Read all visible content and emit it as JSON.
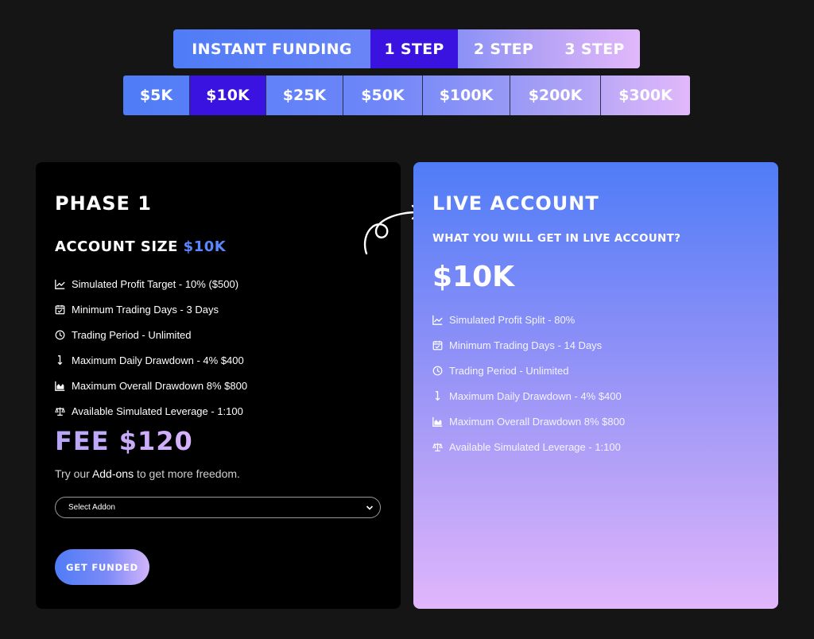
{
  "tabs": [
    {
      "label": "INSTANT FUNDING",
      "active": false
    },
    {
      "label": "1 STEP",
      "active": true
    },
    {
      "label": "2 STEP",
      "active": false
    },
    {
      "label": "3 STEP",
      "active": false
    }
  ],
  "sizes": [
    {
      "label": "$5K",
      "active": false
    },
    {
      "label": "$10K",
      "active": true
    },
    {
      "label": "$25K",
      "active": false
    },
    {
      "label": "$50K",
      "active": false
    },
    {
      "label": "$100K",
      "active": false
    },
    {
      "label": "$200K",
      "active": false
    },
    {
      "label": "$300K",
      "active": false
    }
  ],
  "phase": {
    "title": "PHASE 1",
    "size_label": "ACCOUNT SIZE",
    "size_value": "$10K",
    "features": [
      {
        "icon": "chart-line-icon",
        "text": "Simulated Profit Target - 10% ($500)"
      },
      {
        "icon": "calendar-check-icon",
        "text": "Minimum Trading Days - 3 Days"
      },
      {
        "icon": "clock-icon",
        "text": "Trading Period - Unlimited"
      },
      {
        "icon": "arrow-down-icon",
        "text": "Maximum Daily Drawdown - 4% $400"
      },
      {
        "icon": "area-chart-icon",
        "text": "Maximum Overall Drawdown 8% $800"
      },
      {
        "icon": "scale-icon",
        "text": "Available Simulated Leverage - 1:100"
      }
    ],
    "fee": "FEE $120",
    "addon_prefix": "Try our ",
    "addon_link": "Add-ons",
    "addon_suffix": " to get more freedom.",
    "select_value": "Select Addon",
    "cta": "GET FUNDED"
  },
  "live": {
    "title": "LIVE ACCOUNT",
    "subtitle": "WHAT YOU WILL GET IN LIVE ACCOUNT?",
    "amount": "$10K",
    "features": [
      {
        "icon": "chart-line-icon",
        "text": "Simulated Profit Split - 80%"
      },
      {
        "icon": "calendar-check-icon",
        "text": "Minimum Trading Days - 14 Days"
      },
      {
        "icon": "clock-icon",
        "text": "Trading Period - Unlimited"
      },
      {
        "icon": "arrow-down-icon",
        "text": "Maximum Daily Drawdown - 4% $400"
      },
      {
        "icon": "area-chart-icon",
        "text": "Maximum Overall Drawdown 8% $800"
      },
      {
        "icon": "scale-icon",
        "text": "Available Simulated Leverage - 1:100"
      }
    ]
  },
  "colors": {
    "accent": "#3a13e0",
    "brand_blue": "#4f7cf7",
    "brand_pink": "#e0b6fc",
    "page_bg": "#151515"
  }
}
